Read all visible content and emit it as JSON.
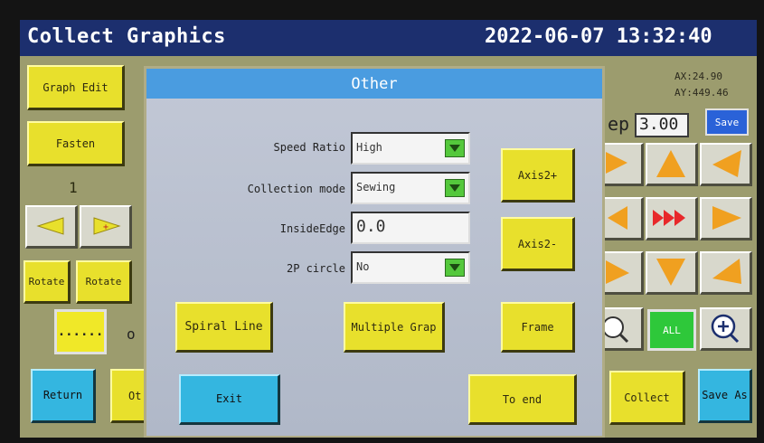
{
  "header": {
    "title": "Collect Graphics",
    "datetime": "2022-06-07 13:32:40"
  },
  "left_panel": {
    "graph_edit": "Graph Edit",
    "fasten": "Fasten",
    "counter": "1",
    "rotate_1": "Rotate",
    "rotate_2": "Rotate",
    "dots_label": "......",
    "o_label": "o"
  },
  "right_panel": {
    "ax": "AX:24.90",
    "ay": "AY:449.46",
    "step_prefix": "ep",
    "step_value": "3.00",
    "save": "Save",
    "all": "ALL"
  },
  "bottom_bar": {
    "return": "Return",
    "other_partial": "Ot",
    "collect": "Collect",
    "save_as": "Save As"
  },
  "dialog": {
    "title": "Other",
    "speed_ratio": {
      "label": "Speed Ratio",
      "value": "High"
    },
    "collection_mode": {
      "label": "Collection mode",
      "value": "Sewing"
    },
    "inside_edge": {
      "label": "InsideEdge",
      "value": "0.0"
    },
    "two_p_circle": {
      "label": "2P circle",
      "value": "No"
    },
    "axis2_plus": "Axis2+",
    "axis2_minus": "Axis2-",
    "spiral_line": "Spiral Line",
    "multiple_graph": "Multiple Grap",
    "frame": "Frame",
    "exit": "Exit",
    "to_end": "To end"
  },
  "colors": {
    "title_bar": "#1c2f6e",
    "button_yellow": "#e8e02c",
    "button_cyan": "#34b6e0",
    "dialog_header": "#4a9ce0",
    "arrow_orange": "#f0a020",
    "arrow_red": "#e8282a",
    "dropdown_green": "#54c83c",
    "all_green": "#2ec83a",
    "save_blue": "#2a62d8"
  }
}
